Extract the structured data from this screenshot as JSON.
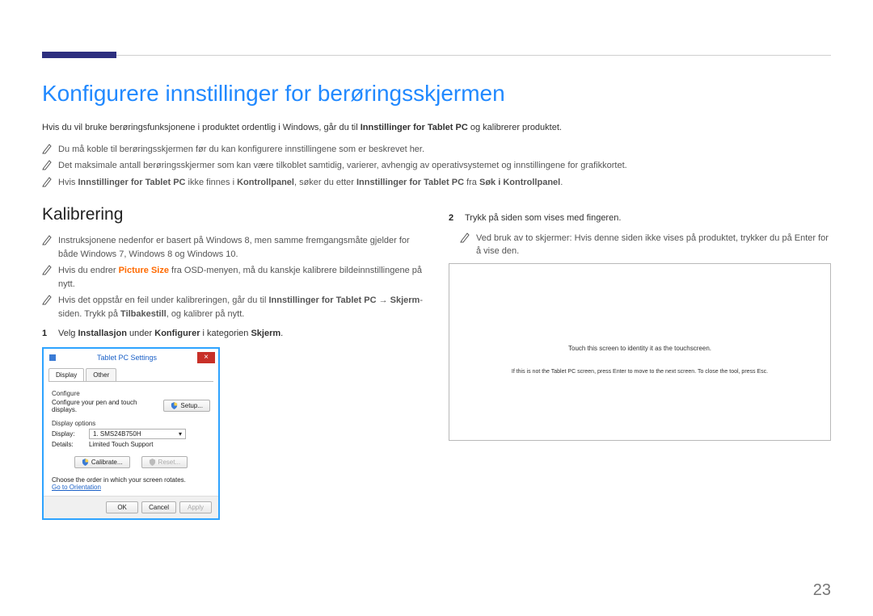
{
  "header": {
    "accent_color": "#2d2f7f"
  },
  "titles": {
    "main": "Konfigurere innstillinger for berøringsskjermen",
    "sub": "Kalibrering"
  },
  "intro": {
    "text_a": "Hvis du vil bruke berøringsfunksjonene i produktet ordentlig i Windows, går du til ",
    "text_b": "Innstillinger for Tablet PC",
    "text_c": " og kalibrerer produktet."
  },
  "notes_top": [
    "Du må koble til berøringsskjermen før du kan konfigurere innstillingene som er beskrevet her.",
    "Det maksimale antall berøringsskjermer som kan være tilkoblet samtidig, varierer, avhengig av operativsystemet og innstillingene for grafikkortet."
  ],
  "note_top_3": {
    "a": "Hvis ",
    "b": "Innstillinger for Tablet PC",
    "c": " ikke finnes i ",
    "d": "Kontrollpanel",
    "e": ", søker du etter ",
    "f": "Innstillinger for Tablet PC",
    "g": " fra ",
    "h": "Søk i Kontrollpanel",
    "i": "."
  },
  "left": {
    "note1": "Instruksjonene nedenfor er basert på Windows 8, men samme fremgangsmåte gjelder for både Windows 7, Windows 8 og Windows 10.",
    "note2_a": "Hvis du endrer ",
    "note2_b": "Picture Size",
    "note2_c": " fra OSD-menyen, må du kanskje kalibrere bildeinnstillingene på nytt.",
    "note3_a": "Hvis det oppstår en feil under kalibreringen, går du til ",
    "note3_b": "Innstillinger for Tablet PC",
    "note3_arrow": " → ",
    "note3_c": "Skjerm",
    "note3_d": "-siden. Trykk på ",
    "note3_e": "Tilbakestill",
    "note3_f": ", og kalibrer på nytt.",
    "step1_num": "1",
    "step1_a": "Velg ",
    "step1_b": "Installasjon",
    "step1_c": " under ",
    "step1_d": "Konfigurer",
    "step1_e": " i kategorien ",
    "step1_f": "Skjerm",
    "step1_g": "."
  },
  "right": {
    "step2_num": "2",
    "step2": "Trykk på siden som vises med fingeren.",
    "note": "Ved bruk av to skjermer: Hvis denne siden ikke vises på produktet, trykker du på Enter for å vise den.",
    "instr1": "Touch this screen to identity it as the touchscreen.",
    "instr2": "If this is not the Tablet PC screen, press Enter to move to the next screen. To close the tool, press Esc."
  },
  "window": {
    "title": "Tablet PC Settings",
    "tabs": {
      "display": "Display",
      "other": "Other"
    },
    "configure_heading": "Configure",
    "configure_text": "Configure your pen and touch displays.",
    "setup_btn": "Setup...",
    "display_options": "Display options",
    "display_label": "Display:",
    "display_value": "1. SMS24B750H",
    "details_label": "Details:",
    "details_value": "Limited Touch Support",
    "calibrate_btn": "Calibrate...",
    "reset_btn": "Reset...",
    "orient_text": "Choose the order in which your screen rotates.",
    "orient_link": "Go to Orientation",
    "ok": "OK",
    "cancel": "Cancel",
    "apply": "Apply"
  },
  "page_number": "23"
}
